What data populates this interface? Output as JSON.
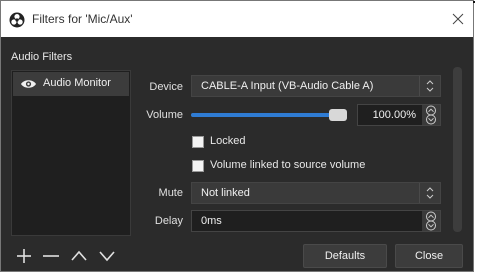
{
  "window": {
    "title": "Filters for 'Mic/Aux'"
  },
  "filters_panel": {
    "label": "Audio Filters",
    "items": [
      {
        "name": "Audio Monitor",
        "visible": true
      }
    ]
  },
  "settings": {
    "device": {
      "label": "Device",
      "value": "CABLE-A Input (VB-Audio Cable A)"
    },
    "volume": {
      "label": "Volume",
      "value": "100.00%",
      "level": 1.0
    },
    "locked": {
      "label": "Locked",
      "checked": false
    },
    "volume_linked": {
      "label": "Volume linked to source volume",
      "checked": false
    },
    "mute": {
      "label": "Mute",
      "value": "Not linked"
    },
    "delay": {
      "label": "Delay",
      "value": "0ms"
    }
  },
  "toolbar": {
    "add_icon": "plus-icon",
    "remove_icon": "minus-icon",
    "up_icon": "chevron-up-icon",
    "down_icon": "chevron-down-icon"
  },
  "buttons": {
    "defaults_label": "Defaults",
    "close_label": "Close"
  },
  "colors": {
    "background": "#2b2b2b",
    "accent": "#2f7cd4"
  }
}
